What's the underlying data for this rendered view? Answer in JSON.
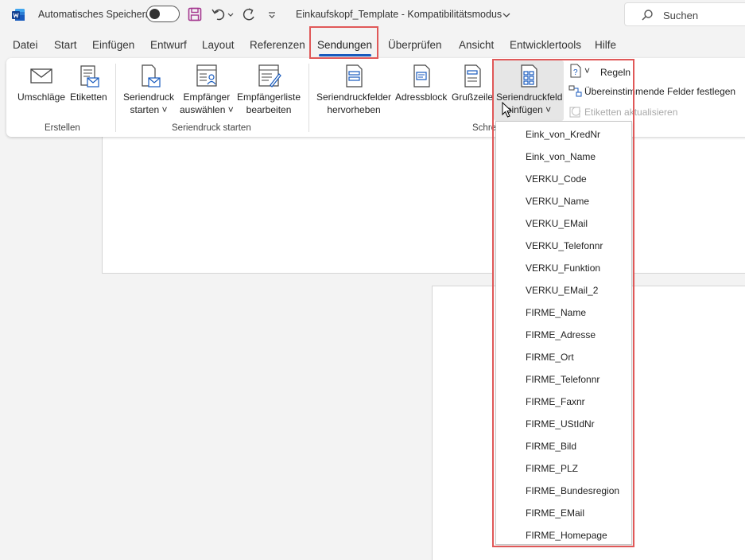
{
  "titlebar": {
    "autosave_label": "Automatisches Speichern",
    "document_title": "Einkaufskopf_Template  -  Kompatibilitätsmodus",
    "search_placeholder": "Suchen"
  },
  "tabs": [
    {
      "label": "Datei"
    },
    {
      "label": "Start"
    },
    {
      "label": "Einfügen"
    },
    {
      "label": "Entwurf"
    },
    {
      "label": "Layout"
    },
    {
      "label": "Referenzen"
    },
    {
      "label": "Sendungen"
    },
    {
      "label": "Überprüfen"
    },
    {
      "label": "Ansicht"
    },
    {
      "label": "Entwicklertools"
    },
    {
      "label": "Hilfe"
    }
  ],
  "active_tab": "Sendungen",
  "ribbon": {
    "groups": {
      "erstellen": "Erstellen",
      "seriendruck_starten": "Seriendruck starten",
      "schreiben": "Schre"
    },
    "buttons": {
      "umschlaege": "Umschläge",
      "etiketten": "Etiketten",
      "seriendruck_starten_1": "Seriendruck",
      "seriendruck_starten_2": "starten",
      "empfaenger_1": "Empfänger",
      "empfaenger_2": "auswählen",
      "empfaengerliste_1": "Empfängerliste",
      "empfaengerliste_2": "bearbeiten",
      "hervorheben_1": "Seriendruckfelder",
      "hervorheben_2": "hervorheben",
      "adressblock": "Adressblock",
      "grusszeile": "Grußzeile",
      "feld_einfuegen_1": "Seriendruckfeld",
      "feld_einfuegen_2": "einfügen",
      "regeln": "Regeln",
      "felder_festlegen": "Übereinstimmende Felder festlegen",
      "etiketten_aktualisieren": "Etiketten aktualisieren"
    }
  },
  "dropdown_items": [
    "Eink_von_KredNr",
    "Eink_von_Name",
    "VERKU_Code",
    "VERKU_Name",
    "VERKU_EMail",
    "VERKU_Telefonnr",
    "VERKU_Funktion",
    "VERKU_EMail_2",
    "FIRME_Name",
    "FIRME_Adresse",
    "FIRME_Ort",
    "FIRME_Telefonnr",
    "FIRME_Faxnr",
    "FIRME_UStIdNr",
    "FIRME_Bild",
    "FIRME_PLZ",
    "FIRME_Bundesregion",
    "FIRME_EMail",
    "FIRME_Homepage"
  ],
  "colors": {
    "accent": "#185abd",
    "highlight": "#e05858",
    "save_icon": "#a4378f"
  }
}
